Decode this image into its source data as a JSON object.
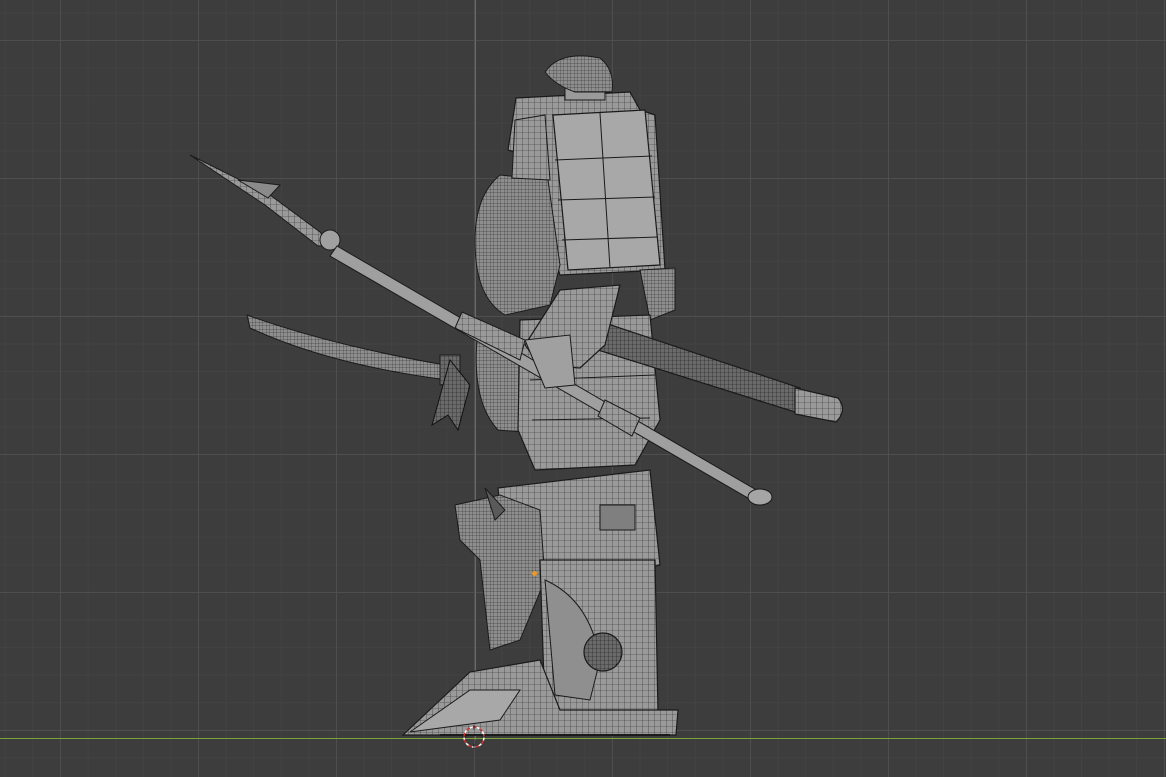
{
  "viewport": {
    "background_color": "#3d3d3d",
    "grid_major_color": "#505050",
    "grid_minor_color": "#464646",
    "axis_z_color": "#3f6fbf",
    "axis_y_color": "#7aa33a",
    "wire_color": "#1a1a1a",
    "surface_color": "#9a9a9a",
    "origin_color": "#e89a2c",
    "cursor_color": "#c83232"
  },
  "scene": {
    "object": "armored-mech-warrior",
    "view": "side-orthographic-wireframe-overlay",
    "props": [
      "spear",
      "sword",
      "staff-mace",
      "backpack"
    ]
  },
  "icons": {
    "cursor": "3d-cursor-icon",
    "origin": "object-origin-icon"
  }
}
